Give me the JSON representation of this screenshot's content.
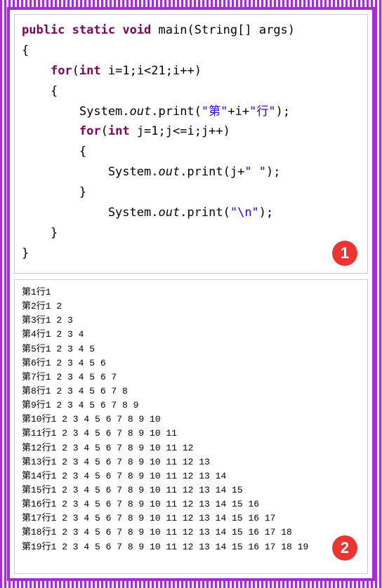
{
  "code": {
    "tokens": [
      [
        [
          "kw",
          "public"
        ],
        [
          "pl",
          " "
        ],
        [
          "kw",
          "static"
        ],
        [
          "pl",
          " "
        ],
        [
          "kw",
          "void"
        ],
        [
          "pl",
          " "
        ],
        [
          "id",
          "main"
        ],
        [
          "pl",
          "(String[] args)"
        ]
      ],
      [
        [
          "pl",
          "{"
        ]
      ],
      [
        [
          "pl",
          "    "
        ],
        [
          "kw",
          "for"
        ],
        [
          "pl",
          "("
        ],
        [
          "kw",
          "int"
        ],
        [
          "pl",
          " i=1;i<21;i++)"
        ]
      ],
      [
        [
          "pl",
          "    {"
        ]
      ],
      [
        [
          "pl",
          "        System."
        ],
        [
          "it",
          "out"
        ],
        [
          "pl",
          ".print("
        ],
        [
          "str",
          "\"第\""
        ],
        [
          "pl",
          "+i+"
        ],
        [
          "str",
          "\"行\""
        ],
        [
          "pl",
          ");"
        ]
      ],
      [
        [
          "pl",
          "        "
        ],
        [
          "kw",
          "for"
        ],
        [
          "pl",
          "("
        ],
        [
          "kw",
          "int"
        ],
        [
          "pl",
          " j=1;j<=i;j++)"
        ]
      ],
      [
        [
          "pl",
          "        {"
        ]
      ],
      [
        [
          "pl",
          "            System."
        ],
        [
          "it",
          "out"
        ],
        [
          "pl",
          ".print(j+"
        ],
        [
          "str",
          "\" \""
        ],
        [
          "pl",
          ");"
        ]
      ],
      [
        [
          "pl",
          "        }"
        ]
      ],
      [
        [
          "pl",
          "            System."
        ],
        [
          "it",
          "out"
        ],
        [
          "pl",
          ".print("
        ],
        [
          "str",
          "\"\\n\""
        ],
        [
          "pl",
          ");"
        ]
      ],
      [
        [
          "pl",
          "    }"
        ]
      ],
      [
        [
          "pl",
          "}"
        ]
      ]
    ]
  },
  "output": {
    "prefix": "第",
    "suffix": "行",
    "rows": 19
  },
  "badges": {
    "code": "1",
    "output": "2"
  }
}
